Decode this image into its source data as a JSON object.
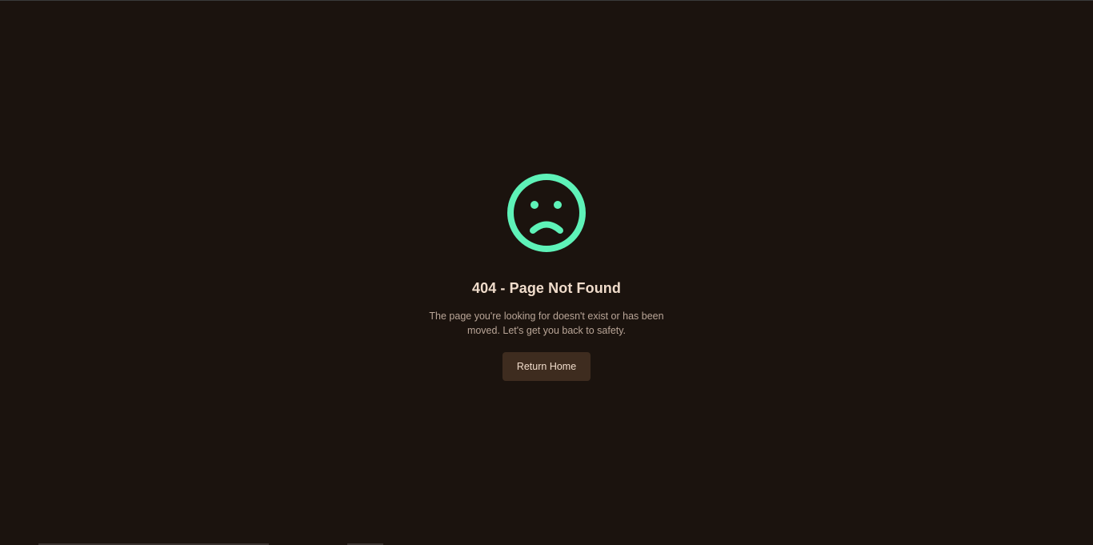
{
  "error": {
    "title": "404 - Page Not Found",
    "message": "The page you're looking for doesn't exist or has been moved. Let's get you back to safety.",
    "icon": "sad-face-icon"
  },
  "actions": {
    "return_home_label": "Return Home"
  },
  "colors": {
    "background": "#1b130e",
    "accent": "#5ef2b8",
    "title_text": "#f0dccb",
    "body_text": "#b9a597",
    "button_background": "#3e2c1f"
  }
}
